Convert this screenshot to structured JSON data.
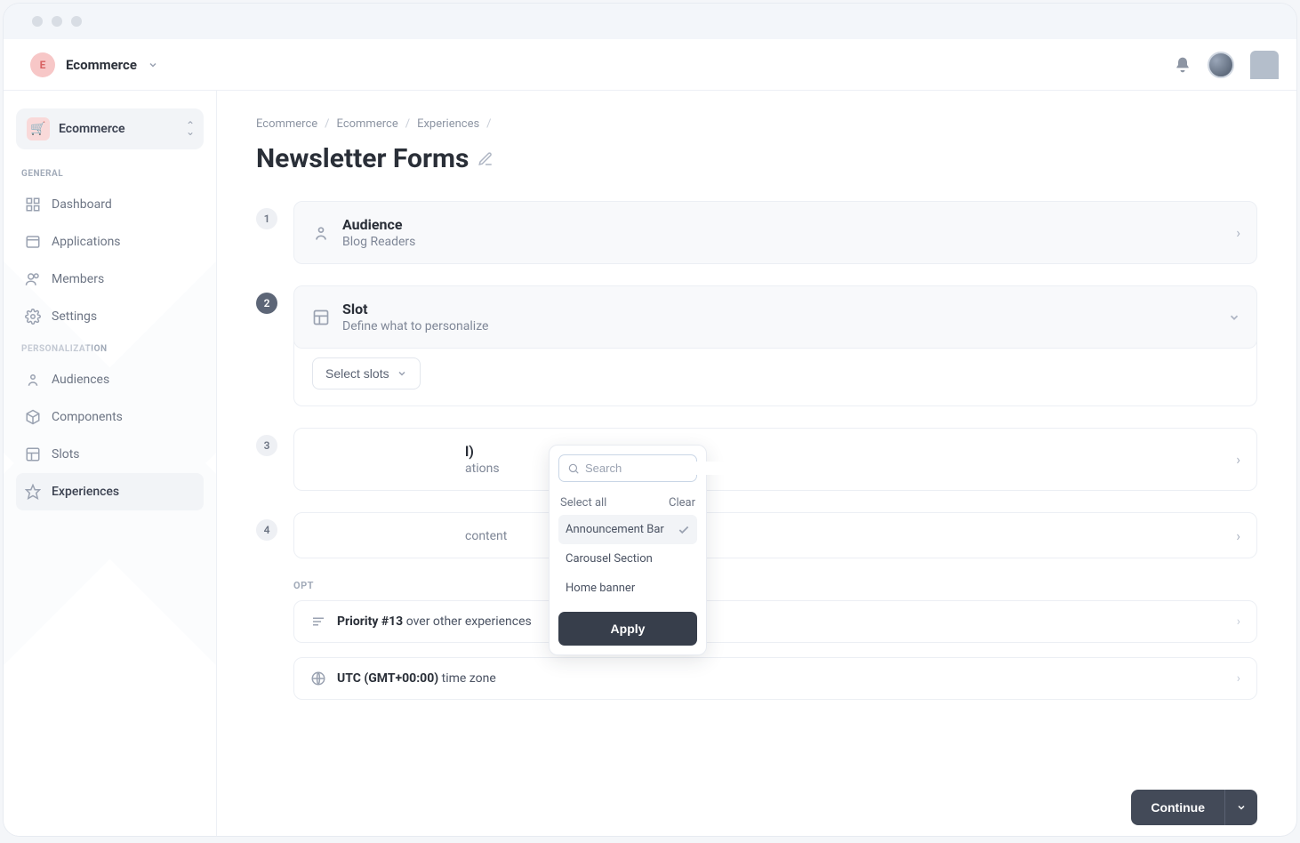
{
  "brand": {
    "initial": "E",
    "name": "Ecommerce"
  },
  "workspace": {
    "name": "Ecommerce"
  },
  "sidebar": {
    "sections": {
      "general": "GENERAL",
      "personalization": "PERSONALIZATION"
    },
    "items": {
      "dashboard": "Dashboard",
      "applications": "Applications",
      "members": "Members",
      "settings": "Settings",
      "audiences": "Audiences",
      "components": "Components",
      "slots": "Slots",
      "experiences": "Experiences"
    }
  },
  "breadcrumbs": {
    "a": "Ecommerce",
    "b": "Ecommerce",
    "c": "Experiences"
  },
  "page": {
    "title": "Newsletter Forms"
  },
  "steps": {
    "audience": {
      "num": "1",
      "title": "Audience",
      "sub": "Blog Readers"
    },
    "slot": {
      "num": "2",
      "title": "Slot",
      "sub": "Define what to personalize",
      "select_label": "Select slots"
    },
    "step3": {
      "num": "3",
      "title_fragment": "l)",
      "sub_fragment": "ations"
    },
    "step4": {
      "num": "4",
      "sub_fragment": "content"
    }
  },
  "dropdown": {
    "search_placeholder": "Search",
    "select_all": "Select all",
    "clear": "Clear",
    "items": [
      {
        "label": "Announcement Bar",
        "selected": true
      },
      {
        "label": "Carousel Section",
        "selected": false
      },
      {
        "label": "Home banner",
        "selected": false
      }
    ],
    "apply": "Apply"
  },
  "options": {
    "section": "OPT",
    "priority_bold": "Priority #13",
    "priority_rest": " over other experiences",
    "tz_bold": "UTC (GMT+00:00)",
    "tz_rest": " time zone"
  },
  "footer": {
    "continue": "Continue"
  }
}
